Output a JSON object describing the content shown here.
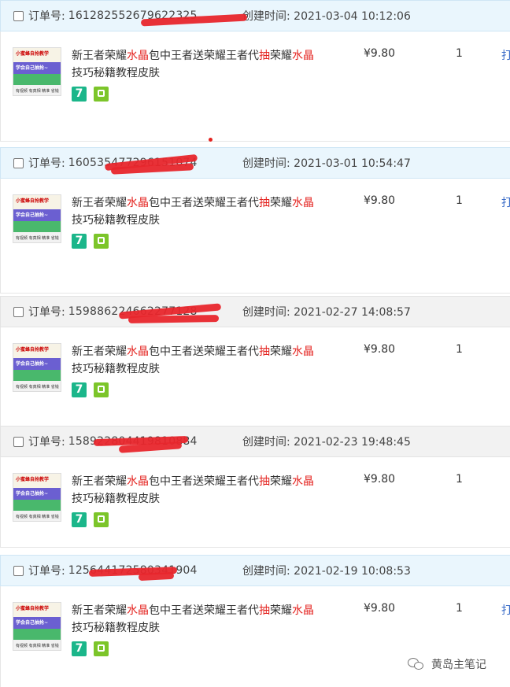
{
  "labels": {
    "order_no": "订单号:",
    "created": "创建时间:",
    "title_parts": [
      "新王者荣耀",
      "水晶",
      "包中王者送荣耀王者代",
      "抽",
      "荣耀",
      "水晶",
      "技巧秘籍教程皮肤"
    ],
    "price": "¥9.80",
    "qty": "1",
    "op": "打",
    "badge7": "7",
    "thumb_top": "小蜜蜂自抢教学",
    "thumb_mid": "学会自己抽抢~",
    "thumb_bottom": "有视频 有真相 精准 省钱"
  },
  "orders": [
    {
      "order_no": "161282552679622325",
      "created_at": "2021-03-04 10:12:06",
      "header": "blue",
      "show_op": true
    },
    {
      "order_no": "160535477296151074",
      "created_at": "2021-03-01 10:54:47",
      "header": "blue",
      "show_op": true
    },
    {
      "order_no": "159886224662277128",
      "created_at": "2021-02-27 14:08:57",
      "header": "gray",
      "show_op": false
    },
    {
      "order_no": "158922804419810884",
      "created_at": "2021-02-23 19:48:45",
      "header": "gray",
      "show_op": false
    },
    {
      "order_no": "125644172580341904",
      "created_at": "2021-02-19 10:08:53",
      "header": "blue",
      "show_op": true
    }
  ],
  "watermark": "黄岛主笔记"
}
